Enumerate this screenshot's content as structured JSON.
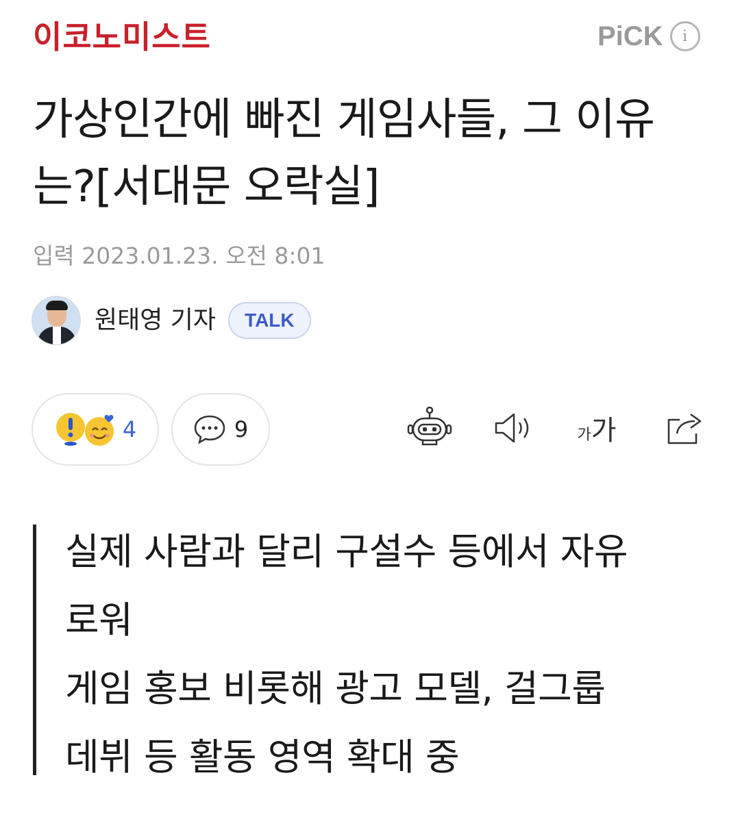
{
  "header": {
    "logo_text": "이코노미스트",
    "pick_label": "PiCK",
    "info_icon": "i",
    "colors": {
      "logo": "#c8202a",
      "pick": "#9a9a9a"
    }
  },
  "article": {
    "title": "가상인간에 빠진 게임사들, 그 이유는?[서대문 오락실]",
    "date": "입력 2023.01.23. 오전 8:01",
    "reporter": {
      "name": "원태영 기자",
      "badge": "TALK"
    }
  },
  "actions": {
    "reaction_count": "4",
    "comment_count": "9",
    "font_small": "가",
    "font_big": "가",
    "icons": [
      "alert-reaction-icon",
      "smile-heart-reaction-icon",
      "comment-bubble-icon",
      "robot-summary-icon",
      "speaker-icon",
      "font-size-icon",
      "share-icon"
    ],
    "accent": "#3a63d8"
  },
  "summary": {
    "lines": [
      "실제 사람과 달리 구설수 등에서 자유",
      "로워",
      "게임 홍보 비롯해 광고 모델, 걸그룹",
      "데뷔 등 활동 영역 확대 중"
    ]
  }
}
